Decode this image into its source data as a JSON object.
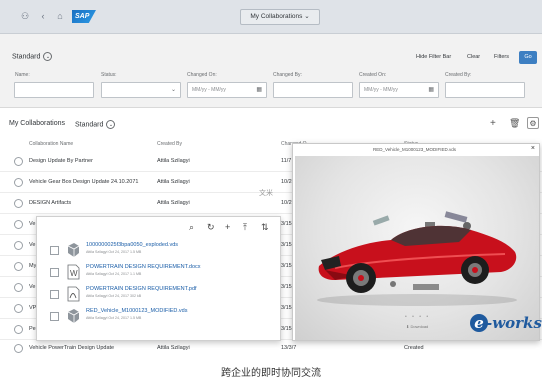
{
  "shellbar": {
    "app_title": "My Collaborations",
    "logo_text": "SAP"
  },
  "filterbar": {
    "variant": "Standard",
    "hide_filter_bar": "Hide Filter Bar",
    "clear": "Clear",
    "filters": "Filters",
    "go": "Go",
    "fields": [
      {
        "label": "Name:",
        "value": ""
      },
      {
        "label": "Status:",
        "value": ""
      },
      {
        "label": "Changed On:",
        "value": "MM/yy - MM/yy"
      },
      {
        "label": "Changed By:",
        "value": ""
      },
      {
        "label": "Created On:",
        "value": "MM/yy - MM/yy"
      },
      {
        "label": "Created By:",
        "value": ""
      }
    ]
  },
  "table": {
    "title": "My Collaborations",
    "variant": "Standard",
    "columns": [
      "Collaboration Name",
      "Created By",
      "Changed O",
      "Status"
    ],
    "rows": [
      {
        "name": "Design Update By Partner",
        "by": "Attila Szilagyi",
        "date": "11/7",
        "status": ""
      },
      {
        "name": "Vehicle Gear Box Design Update 24.10.2071",
        "by": "Attila Szilagyi",
        "date": "10/24",
        "status": ""
      },
      {
        "name": "DESIGN Artifacts",
        "by": "Attila Szilagyi",
        "date": "10/2",
        "status": ""
      },
      {
        "name": "Ve",
        "by": "",
        "date": "3/15",
        "status": ""
      },
      {
        "name": "Ve",
        "by": "",
        "date": "3/15",
        "status": ""
      },
      {
        "name": "My",
        "by": "",
        "date": "3/15",
        "status": ""
      },
      {
        "name": "Ve",
        "by": "",
        "date": "3/15",
        "status": ""
      },
      {
        "name": "VP",
        "by": "",
        "date": "3/15",
        "status": ""
      },
      {
        "name": "Pe",
        "by": "",
        "date": "3/15",
        "status": ""
      },
      {
        "name": "Vehicle PowerTrain Design Update",
        "by": "Attila Szilagyi",
        "date": "13/3/7",
        "status": "Created"
      }
    ]
  },
  "viewer": {
    "title": "RED_Vehicle_M1000123_MODIFIED.vds",
    "close": "×",
    "pager": "• • • •",
    "download": "Download"
  },
  "attachments": {
    "files": [
      {
        "name": "1000000025f3bpa0050_exploded.vds",
        "meta": "Attila Szilagyi    Oct 24, 2017    1.5 MB",
        "icon": "cad-file-icon"
      },
      {
        "name": "POWERTRAIN DESIGN REQUIREMENT.docx",
        "meta": "Attila Szilagyi    Oct 24, 2017    1.1 MB",
        "icon": "word-file-icon"
      },
      {
        "name": "POWERTRAIN DESIGN REQUIREMENT.pdf",
        "meta": "Attila Szilagyi    Oct 24, 2017    302 kB",
        "icon": "pdf-file-icon"
      },
      {
        "name": "RED_Vehicle_M1000123_MODIFIED.vds",
        "meta": "Attila Szilagyi    Oct 24, 2017    1.5 MB",
        "icon": "cad-file-icon"
      }
    ]
  },
  "overlay_text": "文米",
  "logo_watermark": "e-works",
  "caption": "跨企业的即时协同交流",
  "colors": {
    "shell_bg": "#dfe3e8",
    "accent": "#3d7fc2",
    "car_red": "#c8101c",
    "link": "#1b5ea8"
  }
}
